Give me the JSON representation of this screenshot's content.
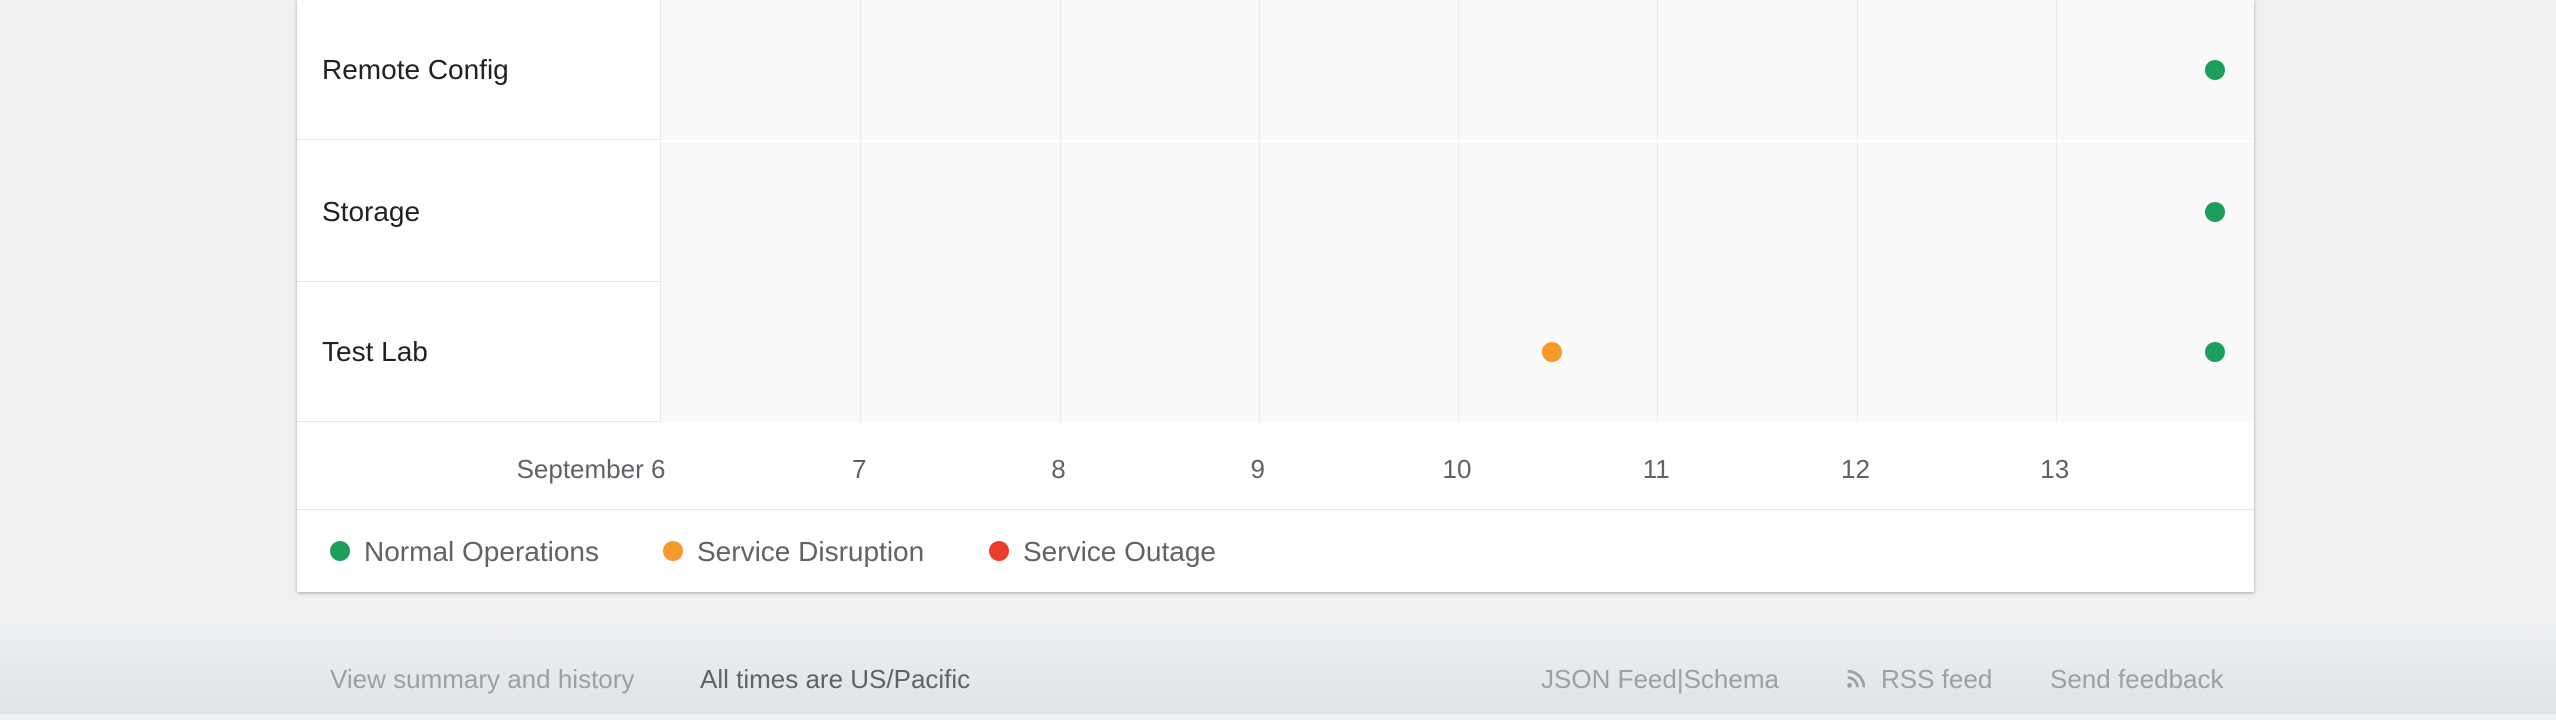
{
  "colors": {
    "normal": "#1e9e5b",
    "disruption": "#f4992a",
    "outage": "#ea3d2a"
  },
  "services": [
    {
      "name": "Remote Config",
      "incidents": [
        {
          "day": "13",
          "fraction": 0.8,
          "status": "normal"
        }
      ]
    },
    {
      "name": "Storage",
      "incidents": [
        {
          "day": "13",
          "fraction": 0.8,
          "status": "normal"
        }
      ]
    },
    {
      "name": "Test Lab",
      "incidents": [
        {
          "day": "10",
          "fraction": 0.47,
          "status": "disruption"
        },
        {
          "day": "13",
          "fraction": 0.8,
          "status": "normal"
        }
      ]
    }
  ],
  "axis": {
    "days": [
      "September 6",
      "7",
      "8",
      "9",
      "10",
      "11",
      "12",
      "13"
    ]
  },
  "legend": [
    {
      "label": "Normal Operations",
      "status": "normal"
    },
    {
      "label": "Service Disruption",
      "status": "disruption"
    },
    {
      "label": "Service Outage",
      "status": "outage"
    }
  ],
  "footer": {
    "summary_link": "View summary and history",
    "timezone_note": "All times are US/Pacific",
    "json_feed": "JSON Feed",
    "separator": "|",
    "schema": "Schema",
    "rss_feed": "RSS feed",
    "send_feedback": "Send feedback"
  }
}
